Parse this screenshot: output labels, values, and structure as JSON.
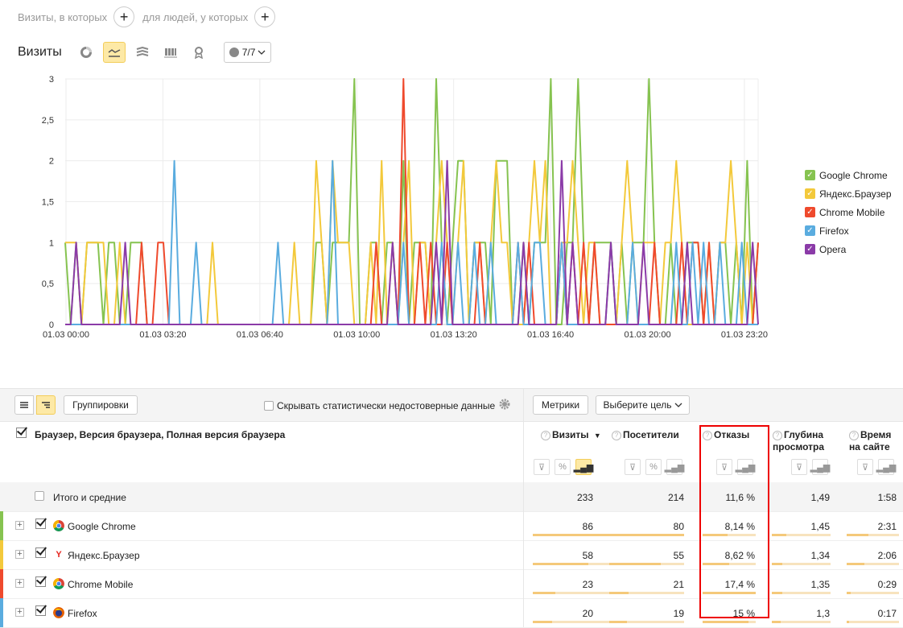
{
  "segment": {
    "visits_label": "Визиты, в которых",
    "people_label": "для людей, у которых"
  },
  "chart_panel": {
    "title": "Визиты",
    "series_count": "7/7"
  },
  "chart_data": {
    "type": "line",
    "x_ticks": [
      "01.03 00:00",
      "01.03 03:20",
      "01.03 06:40",
      "01.03 10:00",
      "01.03 13:20",
      "01.03 16:40",
      "01.03 20:00",
      "01.03 23:20"
    ],
    "y_ticks": [
      "3",
      "2,5",
      "2",
      "1,5",
      "1",
      "0,5",
      "0"
    ],
    "ylim": [
      0,
      3
    ],
    "series": [
      {
        "name": "Google Chrome",
        "color": "#86c350",
        "values": [
          1,
          0,
          1,
          0,
          1,
          1,
          1,
          0,
          1,
          1,
          0,
          0,
          1,
          1,
          1,
          0,
          0,
          0,
          0,
          0,
          0,
          0,
          0,
          0,
          0,
          0,
          0,
          0,
          0,
          0,
          0,
          0,
          0,
          0,
          0,
          0,
          0,
          0,
          0,
          0,
          0,
          0,
          0,
          0,
          0,
          0,
          1,
          1,
          0,
          1,
          1,
          1,
          1,
          3,
          0,
          0,
          1,
          1,
          0,
          1,
          1,
          0,
          2,
          0,
          1,
          1,
          1,
          0,
          3,
          1,
          0,
          1,
          2,
          2,
          0,
          1,
          1,
          1,
          0,
          2,
          2,
          2,
          0,
          0,
          1,
          0,
          1,
          1,
          1,
          3,
          0,
          0,
          1,
          1,
          3,
          1,
          0,
          1,
          1,
          1,
          1,
          0,
          1,
          0,
          1,
          1,
          1,
          3,
          1,
          0,
          0,
          1,
          0,
          0,
          1,
          1,
          1,
          0,
          0,
          0,
          1,
          1,
          0,
          1,
          0,
          2,
          0,
          1
        ]
      },
      {
        "name": "Яндекс.Браузер",
        "color": "#f3c93b",
        "values": [
          1,
          1,
          1,
          0,
          1,
          1,
          1,
          1,
          0,
          0,
          1,
          0,
          0,
          0,
          0,
          0,
          0,
          0,
          0,
          0,
          0,
          0,
          0,
          0,
          0,
          0,
          0,
          1,
          0,
          0,
          0,
          0,
          0,
          0,
          0,
          0,
          0,
          0,
          0,
          0,
          0,
          0,
          1,
          0,
          0,
          0,
          2,
          1,
          0,
          2,
          1,
          1,
          1,
          0,
          0,
          0,
          1,
          0,
          2,
          0,
          1,
          0,
          1,
          2,
          0,
          1,
          1,
          0,
          1,
          2,
          1,
          0,
          1,
          2,
          0,
          1,
          1,
          0,
          1,
          2,
          1,
          1,
          0,
          0,
          0,
          1,
          2,
          1,
          2,
          0,
          0,
          1,
          1,
          2,
          1,
          0,
          1,
          1,
          0,
          0,
          1,
          0,
          1,
          2,
          1,
          0,
          1,
          1,
          1,
          0,
          1,
          1,
          2,
          1,
          0,
          0,
          0,
          0,
          1,
          0,
          1,
          1,
          2,
          1,
          0,
          1,
          0,
          1
        ]
      },
      {
        "name": "Chrome Mobile",
        "color": "#ef4a2d",
        "values": [
          0,
          0,
          0,
          0,
          0,
          0,
          0,
          0,
          0,
          0,
          0,
          0,
          0,
          0,
          1,
          0,
          0,
          1,
          1,
          0,
          0,
          0,
          0,
          0,
          0,
          0,
          0,
          0,
          0,
          0,
          0,
          0,
          0,
          0,
          0,
          0,
          0,
          0,
          0,
          0,
          0,
          0,
          0,
          0,
          0,
          0,
          0,
          0,
          0,
          0,
          0,
          0,
          0,
          0,
          0,
          0,
          0,
          1,
          0,
          0,
          0,
          0,
          3,
          0,
          0,
          1,
          0,
          1,
          0,
          0,
          1,
          0,
          0,
          0,
          0,
          0,
          1,
          0,
          0,
          0,
          0,
          0,
          0,
          1,
          0,
          1,
          0,
          0,
          0,
          0,
          0,
          1,
          0,
          1,
          0,
          1,
          0,
          1,
          0,
          0,
          0,
          0,
          0,
          0,
          0,
          0,
          0,
          0,
          1,
          0,
          0,
          0,
          0,
          1,
          0,
          1,
          1,
          0,
          1,
          0,
          0,
          0,
          0,
          0,
          0,
          0,
          0,
          1
        ]
      },
      {
        "name": "Firefox",
        "color": "#5aacdf",
        "values": [
          0,
          0,
          0,
          0,
          0,
          0,
          0,
          0,
          0,
          0,
          0,
          0,
          0,
          0,
          0,
          0,
          0,
          0,
          0,
          0,
          2,
          0,
          0,
          0,
          1,
          0,
          0,
          0,
          0,
          0,
          0,
          0,
          0,
          0,
          0,
          0,
          0,
          0,
          0,
          1,
          0,
          0,
          0,
          0,
          0,
          0,
          0,
          0,
          0,
          2,
          0,
          0,
          0,
          0,
          0,
          0,
          0,
          0,
          0,
          0,
          0,
          0,
          1,
          0,
          0,
          0,
          0,
          0,
          0,
          1,
          0,
          0,
          1,
          0,
          0,
          1,
          0,
          0,
          1,
          0,
          0,
          0,
          0,
          1,
          0,
          0,
          1,
          1,
          0,
          0,
          0,
          1,
          0,
          0,
          0,
          0,
          0,
          0,
          0,
          0,
          1,
          0,
          0,
          0,
          1,
          0,
          0,
          0,
          0,
          0,
          0,
          0,
          1,
          0,
          0,
          1,
          0,
          1,
          0,
          0,
          1,
          0,
          0,
          0,
          1,
          0,
          0,
          0
        ]
      },
      {
        "name": "Opera",
        "color": "#8b3ba8",
        "values": [
          0,
          0,
          1,
          0,
          0,
          0,
          0,
          0,
          0,
          0,
          0,
          1,
          0,
          0,
          0,
          0,
          0,
          0,
          0,
          0,
          0,
          0,
          0,
          0,
          0,
          0,
          0,
          0,
          0,
          0,
          0,
          0,
          0,
          0,
          0,
          0,
          0,
          0,
          0,
          0,
          0,
          0,
          0,
          0,
          0,
          0,
          0,
          0,
          0,
          0,
          0,
          0,
          0,
          0,
          0,
          0,
          0,
          0,
          0,
          0,
          1,
          0,
          0,
          0,
          0,
          0,
          0,
          0,
          1,
          0,
          2,
          0,
          0,
          0,
          0,
          0,
          0,
          0,
          0,
          0,
          0,
          0,
          0,
          0,
          1,
          0,
          0,
          0,
          0,
          0,
          0,
          2,
          0,
          1,
          0,
          0,
          0,
          0,
          0,
          0,
          1,
          0,
          0,
          0,
          0,
          0,
          1,
          0,
          0,
          0,
          0,
          0,
          0,
          0,
          1,
          0,
          0,
          0,
          0,
          0,
          0,
          0,
          0,
          0,
          0,
          0,
          1,
          0
        ]
      }
    ]
  },
  "table": {
    "tools": {
      "groupings": "Группировки",
      "hide_label": "Скрывать статистически недостоверные данные",
      "metrics": "Метрики",
      "goal": "Выберите цель"
    },
    "dims_label": "Браузер, Версия браузера, Полная версия браузера",
    "columns": {
      "visits": "Визиты",
      "visits_sort": "▼",
      "visitors": "Посетители",
      "bounce": "Отказы",
      "depth_1": "Глубина",
      "depth_2": "просмотра",
      "time_1": "Время",
      "time_2": "на сайте"
    },
    "total": {
      "label": "Итого и средние",
      "visits": "233",
      "visitors": "214",
      "bounce": "11,6 %",
      "depth": "1,49",
      "time": "1:58"
    },
    "rows": [
      {
        "name": "Google Chrome",
        "color": "#86c350",
        "icon": "chrome-icon",
        "visits": "86",
        "visitors": "80",
        "bounce": "8,14 %",
        "depth": "1,45",
        "time": "2:31",
        "visits_share": 1.0,
        "visitors_share": 1.0,
        "bounce_share": 0.47,
        "depth_share": 0.24,
        "time_share": 0.41
      },
      {
        "name": "Яндекс.Браузер",
        "color": "#f3c93b",
        "icon": "yandex-browser-icon",
        "visits": "58",
        "visitors": "55",
        "bounce": "8,62 %",
        "depth": "1,34",
        "time": "2:06",
        "visits_share": 0.67,
        "visitors_share": 0.69,
        "bounce_share": 0.5,
        "depth_share": 0.18,
        "time_share": 0.34
      },
      {
        "name": "Chrome Mobile",
        "color": "#ef4a2d",
        "icon": "chrome-icon",
        "visits": "23",
        "visitors": "21",
        "bounce": "17,4 %",
        "depth": "1,35",
        "time": "0:29",
        "visits_share": 0.27,
        "visitors_share": 0.26,
        "bounce_share": 1.0,
        "depth_share": 0.18,
        "time_share": 0.08
      },
      {
        "name": "Firefox",
        "color": "#5aacdf",
        "icon": "firefox-icon",
        "visits": "20",
        "visitors": "19",
        "bounce": "15 %",
        "depth": "1,3",
        "time": "0:17",
        "visits_share": 0.23,
        "visitors_share": 0.24,
        "bounce_share": 0.86,
        "depth_share": 0.15,
        "time_share": 0.05
      }
    ]
  }
}
